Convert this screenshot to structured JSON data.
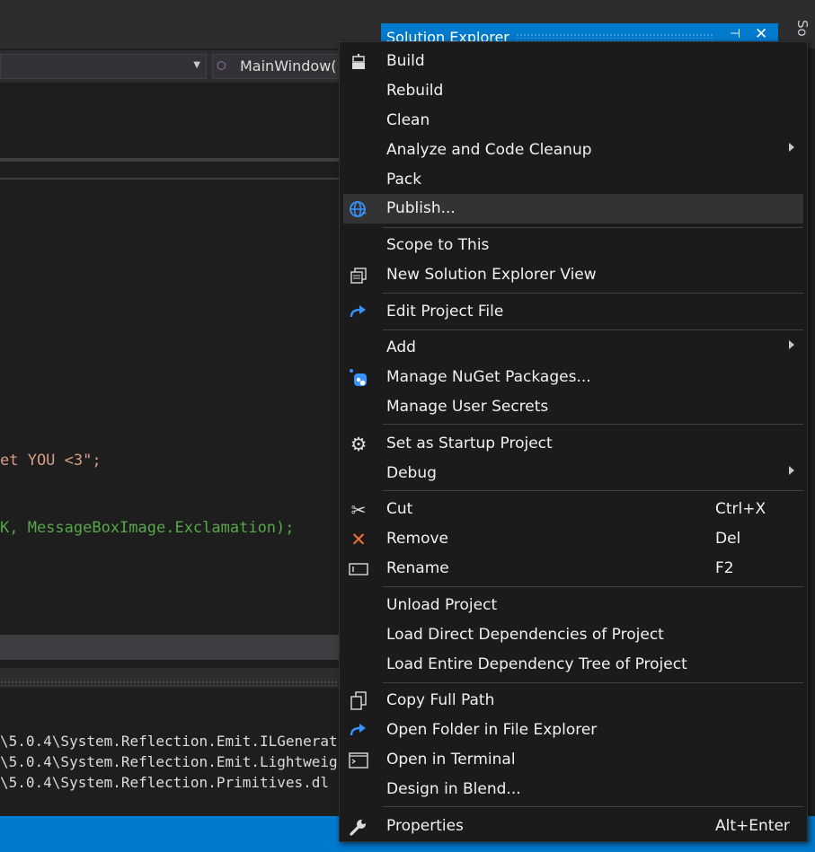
{
  "editor": {
    "member_dropdown": "MainWindow(",
    "code_line1": "et YOU <3\";",
    "code_line2": "K, MessageBoxImage.Exclamation);",
    "output_lines": [
      "\\5.0.4\\System.Reflection.Emit.ILGenerat",
      "\\5.0.4\\System.Reflection.Emit.Lightweig",
      "\\5.0.4\\System.Reflection.Primitives.dl"
    ]
  },
  "solution_explorer": {
    "title": "Solution Explorer",
    "side_label": "So"
  },
  "menu": {
    "build": "Build",
    "rebuild": "Rebuild",
    "clean": "Clean",
    "analyze": "Analyze and Code Cleanup",
    "pack": "Pack",
    "publish": "Publish...",
    "scope": "Scope to This",
    "new_view": "New Solution Explorer View",
    "edit_project": "Edit Project File",
    "add": "Add",
    "nuget": "Manage NuGet Packages...",
    "secrets": "Manage User Secrets",
    "startup": "Set as Startup Project",
    "debug": "Debug",
    "cut": "Cut",
    "cut_shortcut": "Ctrl+X",
    "remove": "Remove",
    "remove_shortcut": "Del",
    "rename": "Rename",
    "rename_shortcut": "F2",
    "unload": "Unload Project",
    "load_direct": "Load Direct Dependencies of Project",
    "load_tree": "Load Entire Dependency Tree of Project",
    "copy_path": "Copy Full Path",
    "open_folder": "Open Folder in File Explorer",
    "open_terminal": "Open in Terminal",
    "design_blend": "Design in Blend...",
    "properties": "Properties",
    "properties_shortcut": "Alt+Enter",
    "highlighted": "Publish..."
  },
  "colors": {
    "accent": "#007acc",
    "menu_bg": "#1b1b1c",
    "highlight": "#333334"
  }
}
